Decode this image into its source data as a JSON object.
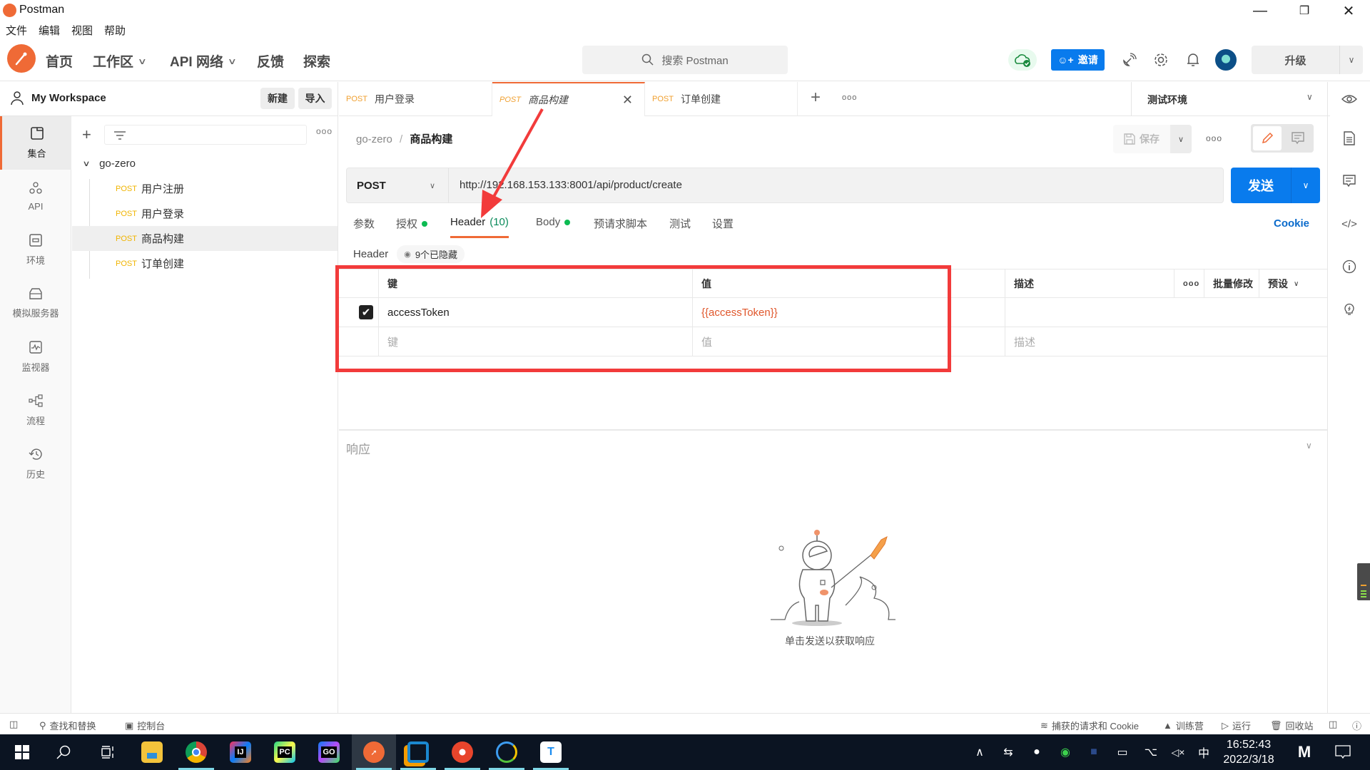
{
  "window": {
    "title": "Postman",
    "controls": [
      "minimize",
      "restore",
      "close"
    ]
  },
  "menu": [
    "文件",
    "编辑",
    "视图",
    "帮助"
  ],
  "header": {
    "nav": [
      {
        "label": "首页",
        "dropdown": false
      },
      {
        "label": "工作区",
        "dropdown": true
      },
      {
        "label": "API 网络",
        "dropdown": true
      },
      {
        "label": "反馈",
        "dropdown": false
      },
      {
        "label": "探索",
        "dropdown": false
      }
    ],
    "search_placeholder": "搜索 Postman",
    "invite_label": "邀请",
    "upgrade_label": "升级",
    "icons": [
      "sync-ok-icon",
      "satellite-icon",
      "settings-icon",
      "bell-icon",
      "avatar"
    ]
  },
  "workspace": {
    "name": "My Workspace",
    "new_label": "新建",
    "import_label": "导入"
  },
  "rail": [
    {
      "label": "集合",
      "icon": "collections-icon",
      "active": true
    },
    {
      "label": "API",
      "icon": "api-icon",
      "active": false
    },
    {
      "label": "环境",
      "icon": "environments-icon",
      "active": false
    },
    {
      "label": "模拟服务器",
      "icon": "mock-server-icon",
      "active": false
    },
    {
      "label": "监视器",
      "icon": "monitor-icon",
      "active": false
    },
    {
      "label": "流程",
      "icon": "flows-icon",
      "active": false
    },
    {
      "label": "历史",
      "icon": "history-icon",
      "active": false
    }
  ],
  "collection": {
    "name": "go-zero",
    "requests": [
      {
        "method": "POST",
        "name": "用户注册",
        "active": false
      },
      {
        "method": "POST",
        "name": "用户登录",
        "active": false
      },
      {
        "method": "POST",
        "name": "商品构建",
        "active": true
      },
      {
        "method": "POST",
        "name": "订单创建",
        "active": false
      }
    ]
  },
  "tabs": [
    {
      "method": "POST",
      "name": "用户登录",
      "active": false
    },
    {
      "method": "POST",
      "name": "商品构建",
      "active": true
    },
    {
      "method": "POST",
      "name": "订单创建",
      "active": false
    }
  ],
  "environment": {
    "selected": "测试环境"
  },
  "request": {
    "breadcrumb_parent": "go-zero",
    "breadcrumb_sep": "/",
    "breadcrumb_current": "商品构建",
    "save_label": "保存",
    "method": "POST",
    "url": "http://192.168.153.133:8001/api/product/create",
    "send_label": "发送",
    "tabs": [
      {
        "label": "参数",
        "dot": false,
        "count": ""
      },
      {
        "label": "授权",
        "dot": true,
        "count": ""
      },
      {
        "label": "Header",
        "dot": false,
        "count": "(10)",
        "active": true
      },
      {
        "label": "Body",
        "dot": true,
        "count": ""
      },
      {
        "label": "预请求脚本",
        "dot": false,
        "count": ""
      },
      {
        "label": "测试",
        "dot": false,
        "count": ""
      },
      {
        "label": "设置",
        "dot": false,
        "count": ""
      }
    ],
    "cookie_label": "Cookie",
    "header_section": "Header",
    "hidden_label": "9个已隐藏"
  },
  "headers_table": {
    "columns": {
      "key": "键",
      "value": "值",
      "description": "描述",
      "bulk_edit": "批量修改",
      "presets": "预设"
    },
    "rows": [
      {
        "checked": true,
        "key": "accessToken",
        "value": "{{accessToken}}",
        "description": ""
      }
    ],
    "placeholder": {
      "key": "键",
      "value": "值",
      "description": "描述"
    }
  },
  "response": {
    "title": "响应",
    "empty_text": "单击发送以获取响应"
  },
  "statusbar": {
    "left": [
      "查找和替换",
      "控制台"
    ],
    "right": [
      "捕获的请求和 Cookie",
      "训练营",
      "运行",
      "回收站"
    ]
  },
  "taskbar": {
    "apps": [
      "file-explorer",
      "chrome",
      "intellij-idea",
      "pycharm",
      "goland",
      "postman",
      "virtualbox",
      "app-swirl",
      "navicat",
      "todesk"
    ],
    "tray": {
      "ime": "中",
      "time": "16:52:43",
      "date": "2022/3/18"
    }
  },
  "colors": {
    "brand": "#ef6a36",
    "primary": "#097bed",
    "method_post": "#f0b400",
    "highlight_box": "#f23b3b",
    "variable": "#e0572c",
    "status_ok": "#0cbb52"
  }
}
